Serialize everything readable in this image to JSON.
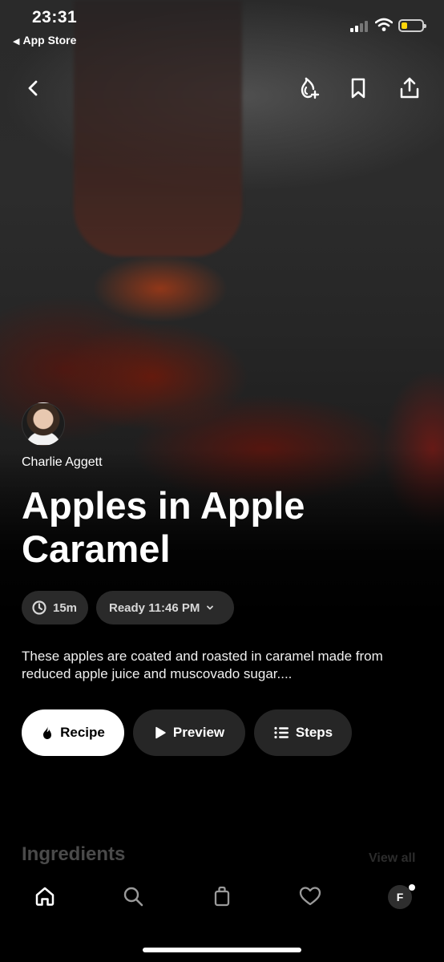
{
  "status_bar": {
    "time": "23:31",
    "back_app": "App Store"
  },
  "nav": {
    "icons": [
      "back-chevron-icon",
      "flame-add-icon",
      "bookmark-icon",
      "share-icon"
    ]
  },
  "recipe": {
    "author": "Charlie Aggett",
    "title": "Apples in Apple Caramel",
    "duration": "15m",
    "ready": "Ready 11:46 PM",
    "description": "These apples are coated and roasted in caramel made from reduced apple juice and muscovado sugar...."
  },
  "actions": {
    "recipe": "Recipe",
    "preview": "Preview",
    "steps": "Steps"
  },
  "section": {
    "ingredients": "Ingredients",
    "view_all": "View all"
  },
  "tabbar": {
    "profile_initial": "F",
    "icons": [
      "home-icon",
      "search-icon",
      "bag-icon",
      "heart-icon"
    ]
  },
  "colors": {
    "background": "#000000",
    "chip": "#2a2a2a",
    "button": "#262626",
    "primary_button": "#ffffff",
    "battery": "#ffd60a"
  }
}
